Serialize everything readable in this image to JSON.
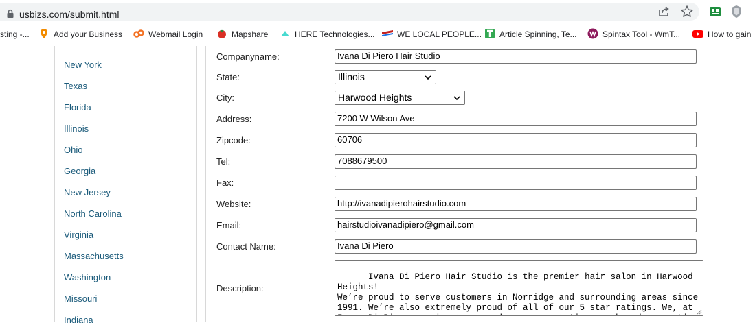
{
  "browser": {
    "url": "usbizs.com/submit.html",
    "bookmarks": [
      {
        "label": "sting -...",
        "icon": "none",
        "color": "#ffffff"
      },
      {
        "label": "Add your Business",
        "icon": "pin-icon",
        "color": "#f28b00"
      },
      {
        "label": "Webmail Login",
        "icon": "link-icon",
        "color": "#f37021"
      },
      {
        "label": "Mapshare",
        "icon": "tomato-icon",
        "color": "#d93025"
      },
      {
        "label": "HERE Technologies...",
        "icon": "here-icon",
        "color": "#48dad0"
      },
      {
        "label": "WE LOCAL PEOPLE...",
        "icon": "flag-icon",
        "color": "#c5221f"
      },
      {
        "label": "Article Spinning, Te...",
        "icon": "t-icon",
        "color": "#34a853"
      },
      {
        "label": "Spintax Tool - WmT...",
        "icon": "spintax-icon",
        "color": "#8e1a5c"
      },
      {
        "label": "How to gain",
        "icon": "youtube-icon",
        "color": "#ff0000"
      }
    ]
  },
  "sidebar": {
    "states": [
      "New York",
      "Texas",
      "Florida",
      "Illinois",
      "Ohio",
      "Georgia",
      "New Jersey",
      "North Carolina",
      "Virginia",
      "Massachusetts",
      "Washington",
      "Missouri",
      "Indiana"
    ]
  },
  "form": {
    "companyname": {
      "label": "Companyname:",
      "value": "Ivana Di Piero Hair Studio"
    },
    "state": {
      "label": "State:",
      "value": "Illinois"
    },
    "city": {
      "label": "City:",
      "value": "Harwood Heights"
    },
    "address": {
      "label": "Address:",
      "value": "7200 W Wilson Ave"
    },
    "zipcode": {
      "label": "Zipcode:",
      "value": "60706"
    },
    "tel": {
      "label": "Tel:",
      "value": "7088679500"
    },
    "fax": {
      "label": "Fax:",
      "value": ""
    },
    "website": {
      "label": "Website:",
      "value": "http://ivanadipierohairstudio.com"
    },
    "email": {
      "label": "Email:",
      "value": "hairstudioivanadipiero@gmail.com"
    },
    "contact": {
      "label": "Contact Name:",
      "value": "Ivana Di Piero"
    },
    "description": {
      "label": "Description:",
      "value": "Ivana Di Piero Hair Studio is the premier hair salon in Harwood Heights!\nWe’re proud to serve customers in Norridge and surrounding areas since\n1991. We’re also extremely proud of all of our 5 star ratings. We, at\nIvana Di Piero, aspire to exceed your expectations each and every time\nyou visit."
    }
  }
}
